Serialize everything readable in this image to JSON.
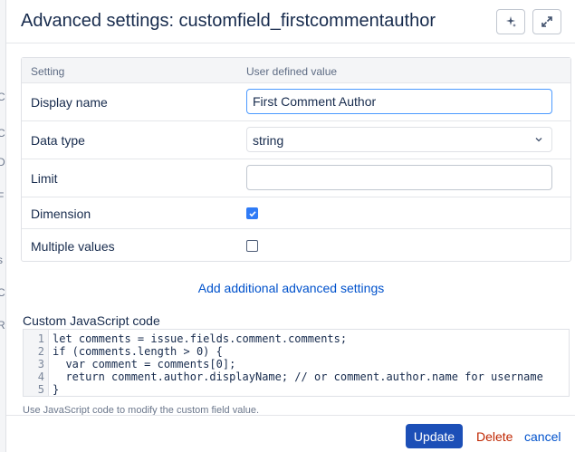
{
  "background": {
    "letters": [
      "C",
      "D",
      "F",
      "s",
      "C",
      "R"
    ]
  },
  "dialog": {
    "title": "Advanced settings: customfield_firstcommentauthor",
    "icons": {
      "ai": "sparkle-icon",
      "expand": "expand-arrows-icon"
    }
  },
  "table": {
    "col_setting": "Setting",
    "col_value": "User defined value",
    "rows": {
      "display_name": {
        "label": "Display name",
        "value": "First Comment Author"
      },
      "data_type": {
        "label": "Data type",
        "value": "string"
      },
      "limit": {
        "label": "Limit",
        "value": ""
      },
      "dimension": {
        "label": "Dimension",
        "checked": true
      },
      "multiple_values": {
        "label": "Multiple values",
        "checked": false
      }
    }
  },
  "add_link": "Add additional advanced settings",
  "code": {
    "label": "Custom JavaScript code",
    "line_numbers": [
      "1",
      "2",
      "3",
      "4",
      "5"
    ],
    "lines": [
      "let comments = issue.fields.comment.comments;",
      "if (comments.length > 0) {",
      "  var comment = comments[0];",
      "  return comment.author.displayName; // or comment.author.name for username",
      "}"
    ],
    "hint": "Use JavaScript code to modify the custom field value."
  },
  "footer": {
    "update": "Update",
    "delete": "Delete",
    "cancel": "cancel"
  },
  "colors": {
    "primary": "#1c4fb7",
    "link": "#0052cc",
    "danger": "#bf2600",
    "checkbox": "#2f7bf6"
  }
}
